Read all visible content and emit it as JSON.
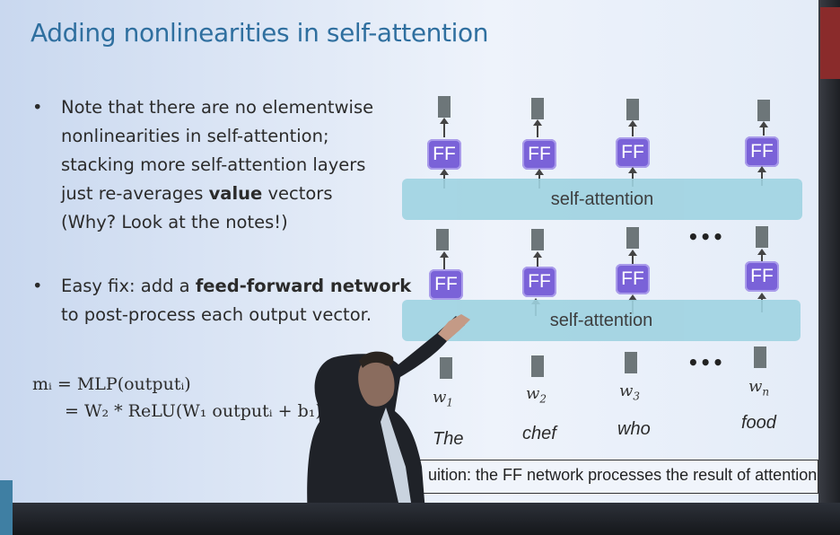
{
  "slide": {
    "title": "Adding nonlinearities in self-attention",
    "bullets": [
      {
        "lines": [
          "Note that there are no elementwise",
          "nonlinearities in self-attention;",
          "stacking more self-attention layers",
          "just re-averages ",
          "value",
          " vectors",
          "(Why? Look at the notes!)"
        ]
      },
      {
        "lines": [
          "Easy fix: add a ",
          "feed-forward network",
          "to post-process each output vector."
        ]
      }
    ],
    "equation": {
      "line1": "mᵢ = MLP(outputᵢ)",
      "line2": "= W₂ * ReLU(W₁ outputᵢ + b₁)"
    },
    "diagram": {
      "self_attention_label": "self-attention",
      "ff_label": "FF",
      "ellipsis": "•••",
      "word_vars": [
        "w",
        "w",
        "w",
        "w"
      ],
      "word_subs": [
        "1",
        "2",
        "3",
        "n"
      ],
      "words": [
        "The",
        "chef",
        "who",
        "food"
      ]
    },
    "intuition": "uition: the FF network processes the result of attention"
  },
  "colors": {
    "title": "#2f6f9f",
    "ff_box": "#7a62d8",
    "self_attention_bar": "#9fd3e1",
    "vector": "#6d7679"
  }
}
